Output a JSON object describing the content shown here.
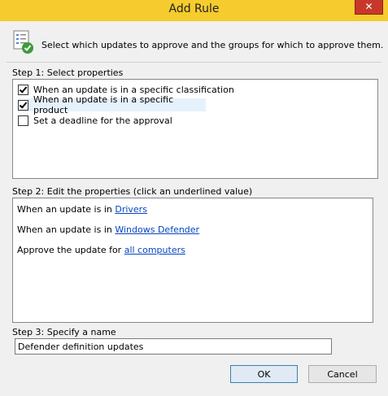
{
  "window": {
    "title": "Add Rule",
    "close_glyph": "✕"
  },
  "header": {
    "text": "Select which updates to approve and the groups for which to approve them.",
    "icon": "checklist-approve-icon"
  },
  "step1": {
    "label": "Step 1: Select properties",
    "properties": [
      {
        "label": "When an update is in a specific classification",
        "checked": true
      },
      {
        "label": "When an update is in a specific product",
        "checked": true
      },
      {
        "label": "Set a deadline for the approval",
        "checked": false
      }
    ]
  },
  "step2": {
    "label": "Step 2: Edit the properties (click an underlined value)",
    "lines": [
      {
        "prefix": "When an update is in ",
        "link": "Drivers"
      },
      {
        "prefix": "When an update is in ",
        "link": "Windows Defender"
      },
      {
        "prefix": "Approve the update for ",
        "link": "all computers"
      }
    ]
  },
  "step3": {
    "label": "Step 3: Specify a name",
    "value": "Defender definition updates"
  },
  "buttons": {
    "ok": "OK",
    "cancel": "Cancel"
  },
  "colors": {
    "titlebar": "#f5cb2e",
    "close": "#c7382b",
    "link": "#0645c2"
  }
}
